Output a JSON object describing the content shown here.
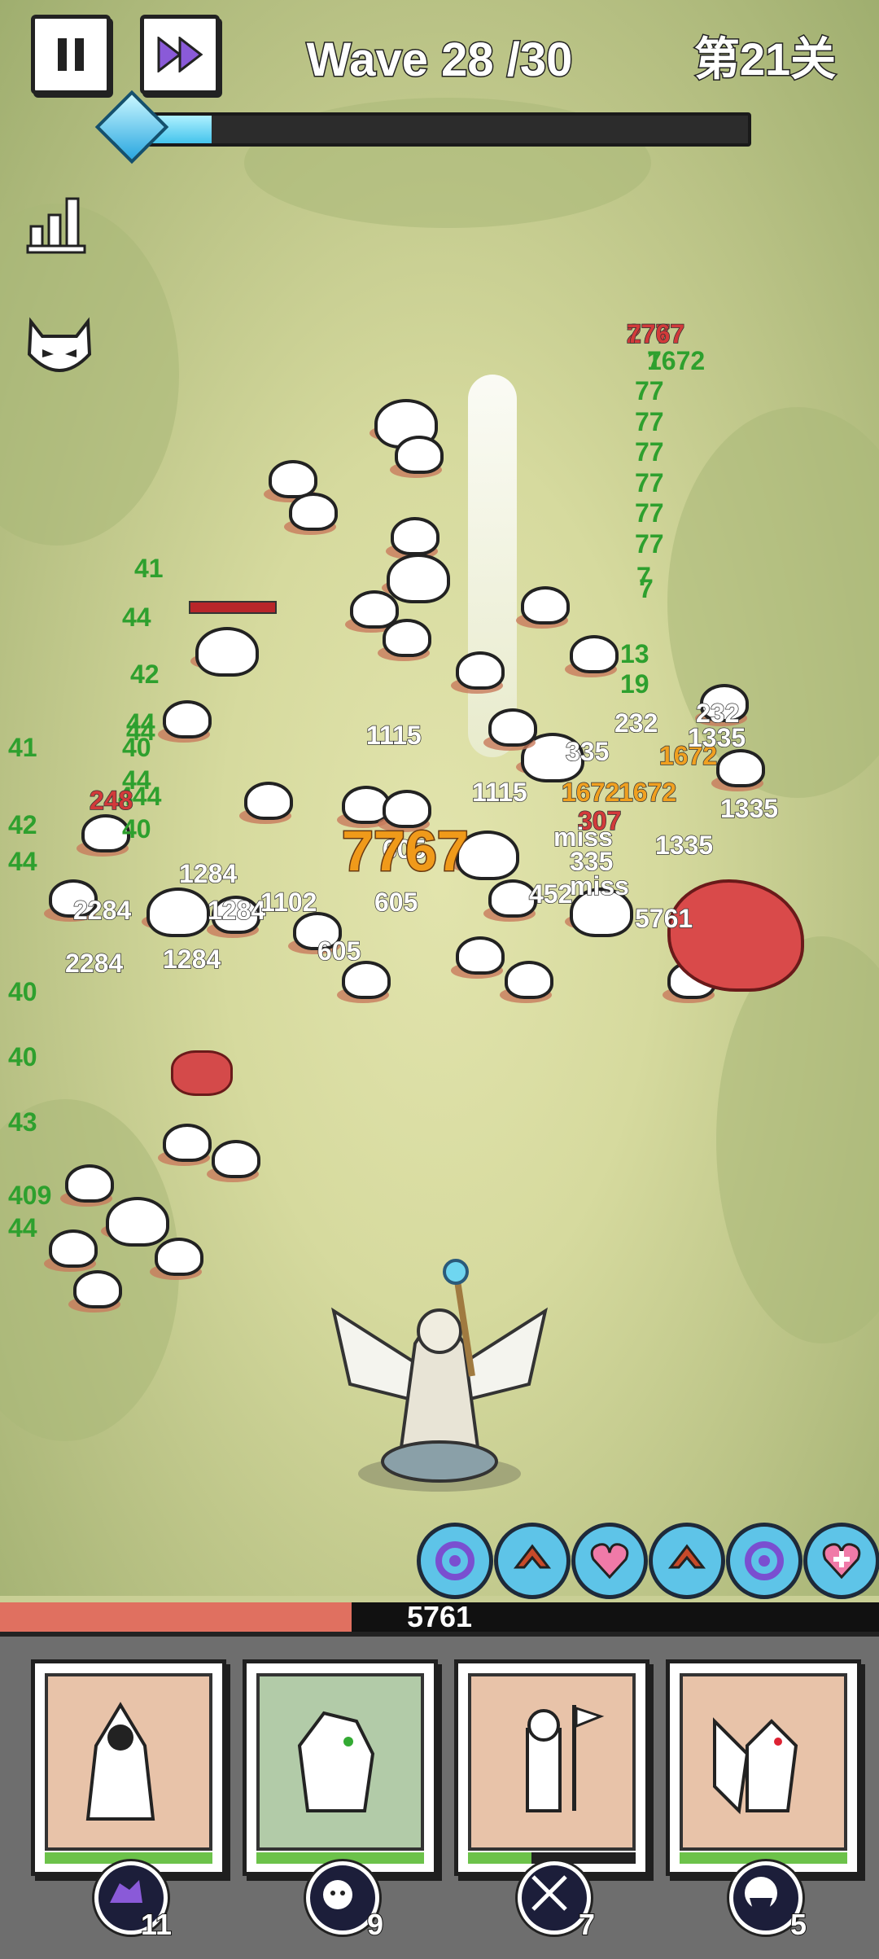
{
  "hud": {
    "wave_text": "Wave 28 /30",
    "level_text": "第21关",
    "wave_progress": 0.15,
    "pause_icon": "pause-icon",
    "speed_icon": "fast-forward-icon",
    "stats_icon": "bar-chart-icon",
    "demon_icon": "demon-face-icon"
  },
  "battle": {
    "damage_numbers": [
      "277",
      "7",
      "77",
      "77",
      "77",
      "77",
      "77",
      "77",
      "7",
      "7",
      "13",
      "19",
      "41",
      "44",
      "42",
      "44",
      "40",
      "44",
      "444",
      "40",
      "44",
      "248",
      "1115",
      "1115",
      "1672",
      "1672",
      "1672",
      "335",
      "335",
      "232",
      "232",
      "1335",
      "1335",
      "1335",
      "307",
      "605",
      "605",
      "605",
      "1284",
      "1284",
      "1284",
      "1102",
      "2284",
      "2284",
      "miss",
      "miss",
      "452",
      "5761",
      "41",
      "42",
      "44",
      "40",
      "43",
      "409",
      "40",
      "44",
      "7767",
      "1672"
    ],
    "big_hit": "7767"
  },
  "skills": [
    {
      "name": "vortex-skill",
      "icon": "vortex-icon"
    },
    {
      "name": "attack-up-skill",
      "icon": "arrow-up-icon"
    },
    {
      "name": "heart-skill",
      "icon": "heart-icon"
    },
    {
      "name": "attack-up-skill-2",
      "icon": "arrow-up-icon"
    },
    {
      "name": "vortex-skill-2",
      "icon": "vortex-icon"
    },
    {
      "name": "heal-skill",
      "icon": "heart-plus-icon"
    }
  ],
  "base_hp": {
    "value": "5761",
    "fraction": 0.4
  },
  "cards": [
    {
      "unit": "hooded-mage",
      "bg": "#e8c3a9",
      "fill": 1.0,
      "cost": "11",
      "cost_icon": "wolf-icon"
    },
    {
      "unit": "armored-beast",
      "bg": "#b2cba8",
      "fill": 1.0,
      "cost": "9",
      "cost_icon": "beast-face-icon"
    },
    {
      "unit": "knight-banner",
      "bg": "#e8c3a9",
      "fill": 0.38,
      "cost": "7",
      "cost_icon": "crossed-swords-icon"
    },
    {
      "unit": "bat-demon",
      "bg": "#e8c3a9",
      "fill": 1.0,
      "cost": "5",
      "cost_icon": "dark-knight-icon"
    }
  ],
  "colors": {
    "hp": "#e07060",
    "bar_green": "#6cc24a",
    "skill_blue": "#5ec4e8",
    "dmg_green": "#2ea02e",
    "dmg_orange": "#f0a020",
    "dmg_red": "#d23a3a"
  }
}
